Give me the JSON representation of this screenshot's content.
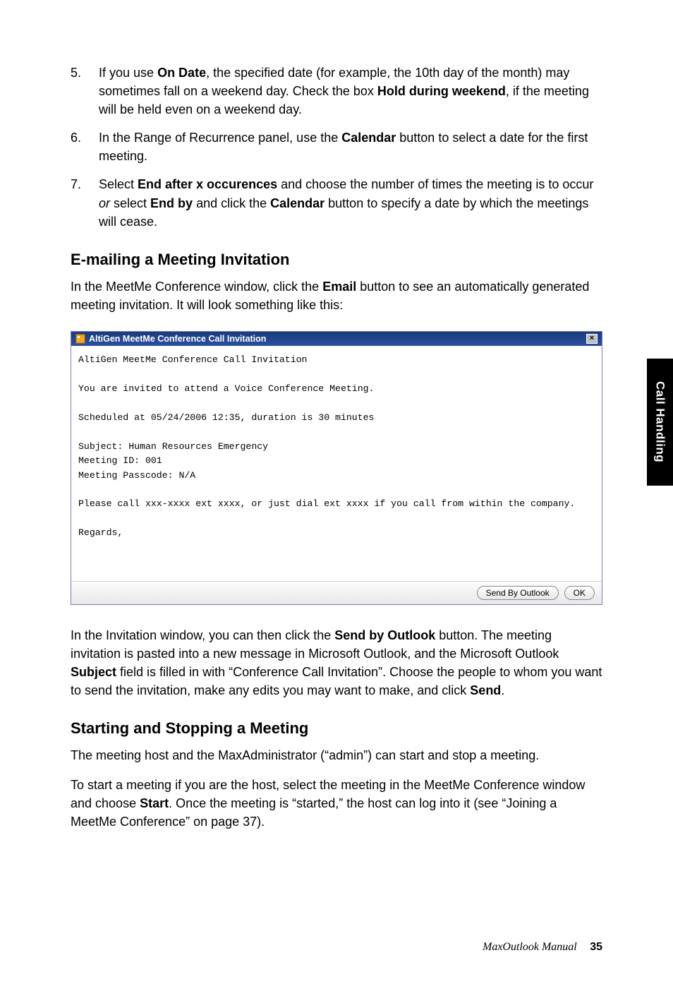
{
  "items": [
    {
      "num": "5.",
      "segments": [
        {
          "t": "If you use "
        },
        {
          "t": "On Date",
          "b": true
        },
        {
          "t": ", the specified date (for example, the 10th day of the month) may sometimes fall on a weekend day. Check the box "
        },
        {
          "t": "Hold during weekend",
          "b": true
        },
        {
          "t": ", if the meeting will be held even on a weekend day."
        }
      ]
    },
    {
      "num": "6.",
      "segments": [
        {
          "t": "In the Range of Recurrence panel, use the "
        },
        {
          "t": "Calendar",
          "b": true
        },
        {
          "t": " button to select a date for the first meeting."
        }
      ]
    },
    {
      "num": "7.",
      "segments": [
        {
          "t": "Select "
        },
        {
          "t": "End after x occurences",
          "b": true
        },
        {
          "t": " and choose the number of times the meeting is to occur "
        },
        {
          "t": "or",
          "i": true
        },
        {
          "t": " select "
        },
        {
          "t": "End by",
          "b": true
        },
        {
          "t": " and click the "
        },
        {
          "t": "Calendar",
          "b": true
        },
        {
          "t": " button to specify a date by which the meetings will cease."
        }
      ]
    }
  ],
  "heading_email": "E-mailing a Meeting Invitation",
  "para_email": [
    {
      "t": "In the MeetMe Conference window, click the "
    },
    {
      "t": "Email",
      "b": true
    },
    {
      "t": " button to see an automatically generated meeting invitation. It will look something like this:"
    }
  ],
  "dialog": {
    "title": "AltiGen MeetMe Conference Call Invitation",
    "close": "×",
    "lines": [
      "AltiGen MeetMe Conference Call Invitation",
      "",
      "You are invited to attend a Voice Conference Meeting.",
      "",
      "Scheduled at 05/24/2006 12:35, duration is 30 minutes",
      "",
      "Subject: Human Resources Emergency",
      "Meeting ID: 001",
      "Meeting Passcode: N/A",
      "",
      "Please call xxx-xxxx ext xxxx, or just dial ext xxxx if you call from within the company.",
      "",
      "Regards,",
      "",
      ""
    ],
    "btn_send": "Send By Outlook",
    "btn_ok": "OK"
  },
  "para_invitation": [
    {
      "t": "In the Invitation window, you can then click the "
    },
    {
      "t": "Send by Outlook",
      "b": true
    },
    {
      "t": " button. The meeting invitation is pasted into a new message in Microsoft Outlook, and the Microsoft Outlook "
    },
    {
      "t": "Subject",
      "b": true
    },
    {
      "t": " field is filled in with “Conference Call Invitation”. Choose the people to whom you want to send the invitation, make any edits you may want to make, and click "
    },
    {
      "t": "Send",
      "b": true
    },
    {
      "t": "."
    }
  ],
  "heading_start": "Starting and Stopping a Meeting",
  "para_start1": [
    {
      "t": "The meeting host and the MaxAdministrator (“admin”) can start and stop a meeting."
    }
  ],
  "para_start2": [
    {
      "t": "To start a meeting if you are the host, select the meeting in the MeetMe Conference window and choose "
    },
    {
      "t": "Start",
      "b": true
    },
    {
      "t": ". Once the meeting is “started,” the host can log into it (see “Joining a MeetMe Conference” on page 37)."
    }
  ],
  "sidetab": "Call Handling",
  "footer_title": "MaxOutlook Manual",
  "footer_page": "35"
}
